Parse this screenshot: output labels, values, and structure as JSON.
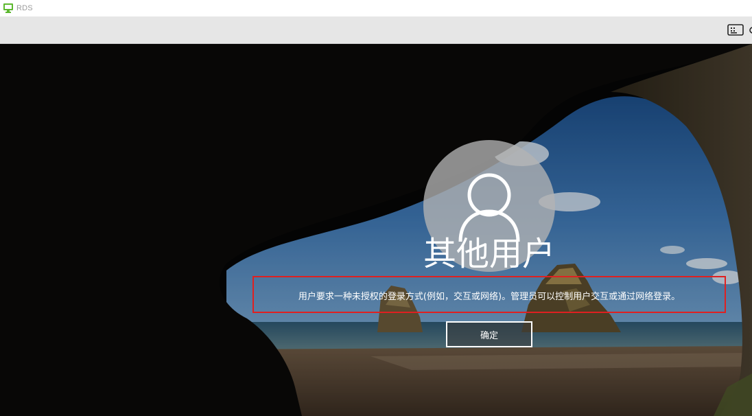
{
  "window": {
    "title": "RDS",
    "icon": "monitor-icon",
    "accent_color": "#5cb82e"
  },
  "toolbar": {
    "keyboard_icon": "keyboard-icon"
  },
  "login": {
    "avatar_icon": "user-icon",
    "username": "其他用户",
    "message": "用户要求一种未授权的登录方式(例如，交互或网络)。管理员可以控制用户交互或通过网络登录。",
    "ok_label": "确定",
    "highlight_color": "#e02020"
  }
}
